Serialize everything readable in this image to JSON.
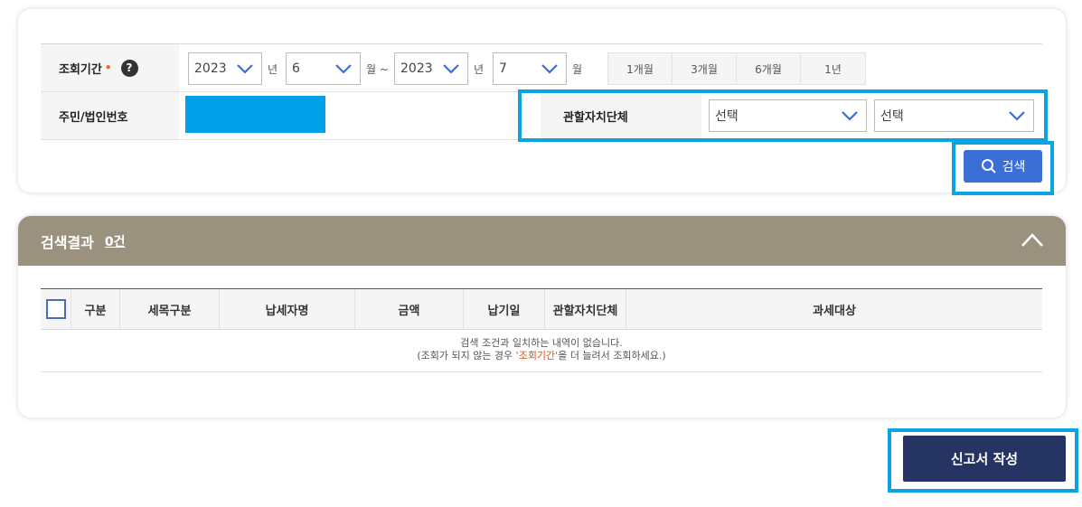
{
  "search": {
    "period_label": "조회기간",
    "required_mark": "•",
    "help_glyph": "?",
    "start_year": "2023",
    "start_month": "6",
    "end_year": "2023",
    "end_month": "7",
    "unit_year": "년",
    "unit_month_range": "월 ~",
    "unit_month": "월",
    "period_buttons": [
      "1개월",
      "3개월",
      "6개월",
      "1년"
    ],
    "id_label": "주민/법인번호",
    "jurisdiction_label": "관할자치단체",
    "jurisdiction_select1": "선택",
    "jurisdiction_select2": "선택",
    "search_button": "검색"
  },
  "results": {
    "title": "검색결과",
    "count": "0건",
    "columns": [
      "구분",
      "세목구분",
      "납세자명",
      "금액",
      "납기일",
      "관할자치단체",
      "과세대상"
    ],
    "empty_line1": "검색 조건과 일치하는 내역이 없습니다.",
    "empty_line2_pre": "(조회가 되지 않는 경우 ",
    "empty_line2_hl": "'조회기간'",
    "empty_line2_post": "을 더 늘려서 조회하세요.)"
  },
  "submit_button": "신고서 작성",
  "colors": {
    "accent_frame": "#0aa3e3",
    "search_button": "#3b6fd6",
    "result_header": "#9b917f",
    "submit_button": "#263463",
    "id_mask": "#00a0e9"
  },
  "icons": {
    "help": "question-circle-icon",
    "dropdown": "chevron-down-icon",
    "search": "magnifier-icon",
    "collapse": "chevron-up-icon"
  }
}
